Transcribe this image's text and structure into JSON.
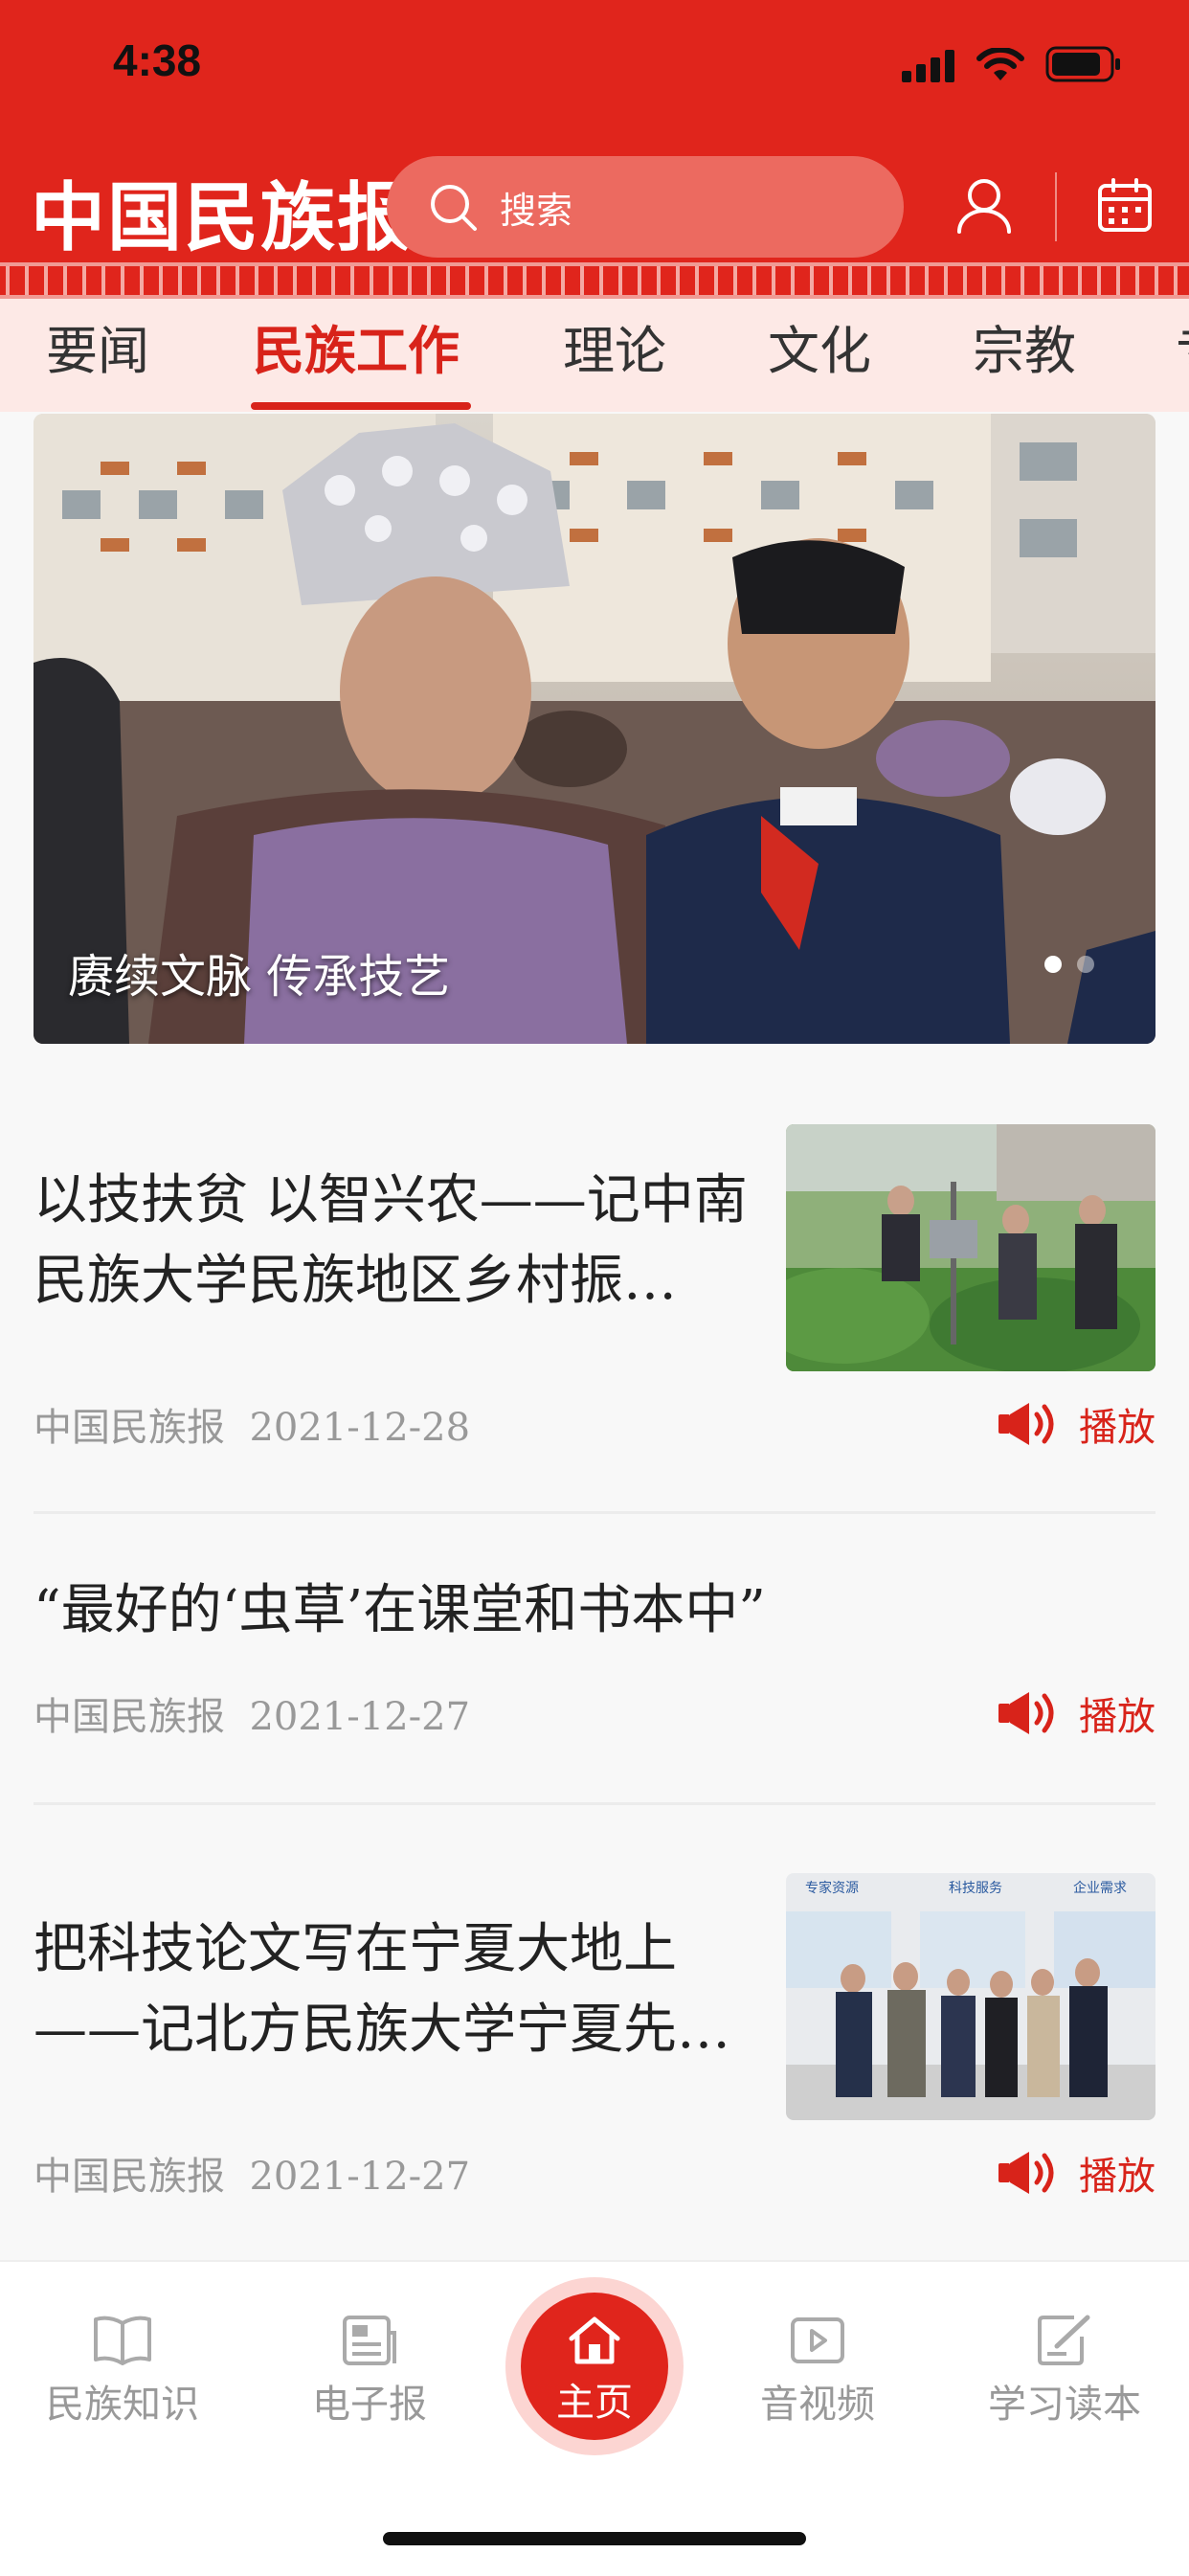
{
  "status": {
    "time": "4:38"
  },
  "header": {
    "logo": "中国民族报",
    "search_placeholder": "搜索",
    "user_icon": "user-icon",
    "calendar_icon": "calendar-icon"
  },
  "tabs": [
    {
      "label": "要闻"
    },
    {
      "label": "民族工作",
      "active": true
    },
    {
      "label": "理论"
    },
    {
      "label": "文化"
    },
    {
      "label": "宗教"
    },
    {
      "label": "专"
    }
  ],
  "banner": {
    "caption": "赓续文脉  传承技艺",
    "slides": 2,
    "active_slide": 1
  },
  "articles": [
    {
      "title": "以技扶贫  以智兴农——记中南民族大学民族地区乡村振…",
      "source": "中国民族报",
      "date": "2021-12-28",
      "play_label": "播放",
      "has_thumb": true
    },
    {
      "title": "“最好的‘虫草’在课堂和书本中”",
      "source": "中国民族报",
      "date": "2021-12-27",
      "play_label": "播放",
      "has_thumb": false
    },
    {
      "title": "把科技论文写在宁夏大地上——记北方民族大学宁夏先…",
      "source": "中国民族报",
      "date": "2021-12-27",
      "play_label": "播放",
      "has_thumb": true,
      "thumb_text": [
        "专家资源",
        "科技服务",
        "企业需求"
      ]
    }
  ],
  "bottom_nav": [
    {
      "label": "民族知识",
      "icon": "book-icon"
    },
    {
      "label": "电子报",
      "icon": "newspaper-icon"
    },
    {
      "label": "主页",
      "icon": "home-icon",
      "active": true
    },
    {
      "label": "音视频",
      "icon": "video-icon"
    },
    {
      "label": "学习读本",
      "icon": "edit-icon"
    }
  ],
  "colors": {
    "brand": "#e0251c",
    "accent": "#d8231a"
  }
}
